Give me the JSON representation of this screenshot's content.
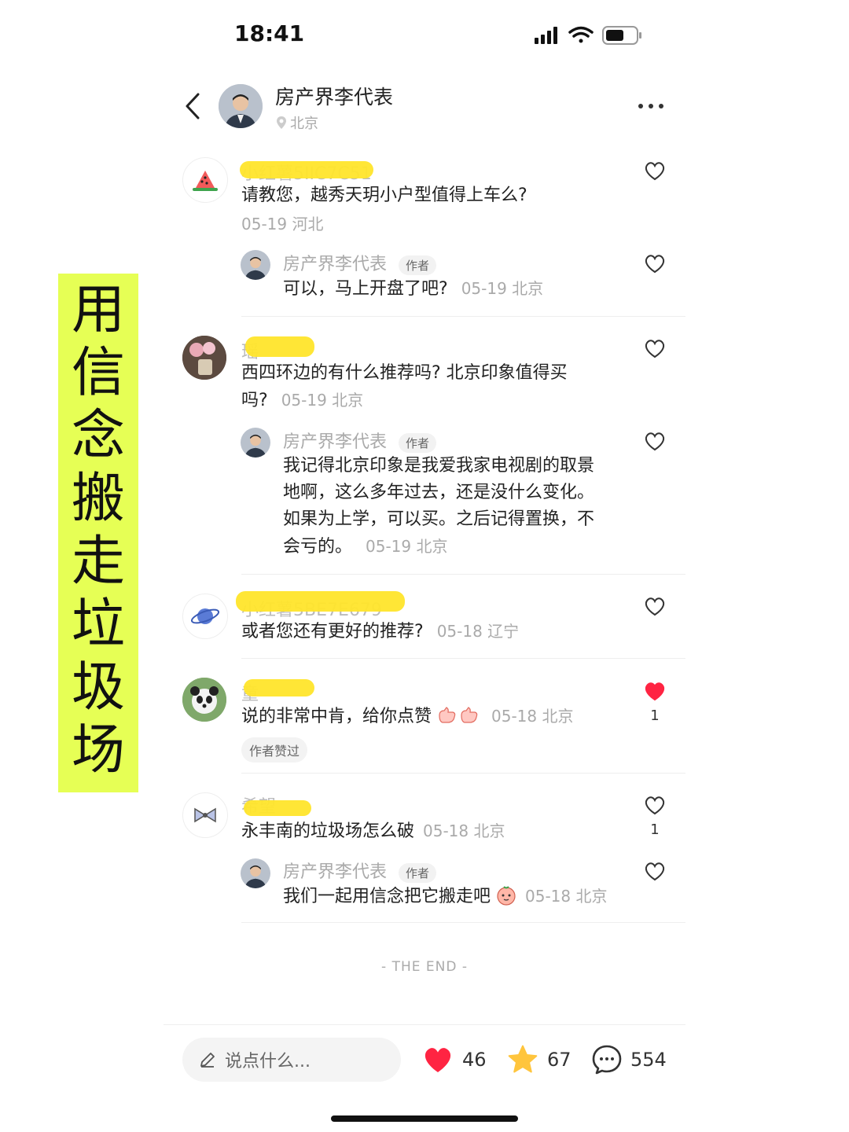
{
  "status_bar": {
    "time": "18:41"
  },
  "header": {
    "name": "房产界李代表",
    "location": "北京"
  },
  "overlay_text": [
    "用",
    "信",
    "念",
    "搬",
    "走",
    "垃",
    "圾",
    "场"
  ],
  "comments": [
    {
      "username": "小红薯5IIC7C51",
      "text": "请教您，越秀天玥小户型值得上车么?",
      "meta": "05-19 河北",
      "reply": {
        "name": "房产界李代表",
        "badge": "作者",
        "text": "可以，马上开盘了吧?",
        "meta": "05-19 北京"
      }
    },
    {
      "username": "瑶",
      "text_line1": "西四环边的有什么推荐吗? 北京印象值得买",
      "text_line2": "吗?",
      "meta": "05-19 北京",
      "reply": {
        "name": "房产界李代表",
        "badge": "作者",
        "lines": [
          "我记得北京印象是我爱我家电视剧的取景",
          "地啊，这么多年过去，还是没什么变化。",
          "如果为上学，可以买。之后记得置换，不",
          "会亏的。"
        ],
        "meta": "05-19 北京"
      }
    },
    {
      "username": "小红薯5BE7E679",
      "text": "或者您还有更好的推荐?",
      "meta": "05-18 辽宁"
    },
    {
      "username": "童",
      "text": "说的非常中肯，给你点赞",
      "meta": "05-18 北京",
      "likes": "1",
      "author_liked": "作者赞过"
    },
    {
      "username": "希望",
      "text": "永丰南的垃圾场怎么破",
      "meta": "05-18 北京",
      "likes": "1",
      "reply": {
        "name": "房产界李代表",
        "badge": "作者",
        "text": "我们一起用信念把它搬走吧",
        "meta": "05-18 北京"
      }
    }
  ],
  "footer": {
    "the_end": "- THE END -"
  },
  "bottom_bar": {
    "input_placeholder": "说点什么...",
    "likes": "46",
    "stars": "67",
    "comments": "554"
  },
  "colors": {
    "overlay": "#e6ff55",
    "like_red": "#ff2442",
    "star_yellow": "#ffc53d"
  }
}
